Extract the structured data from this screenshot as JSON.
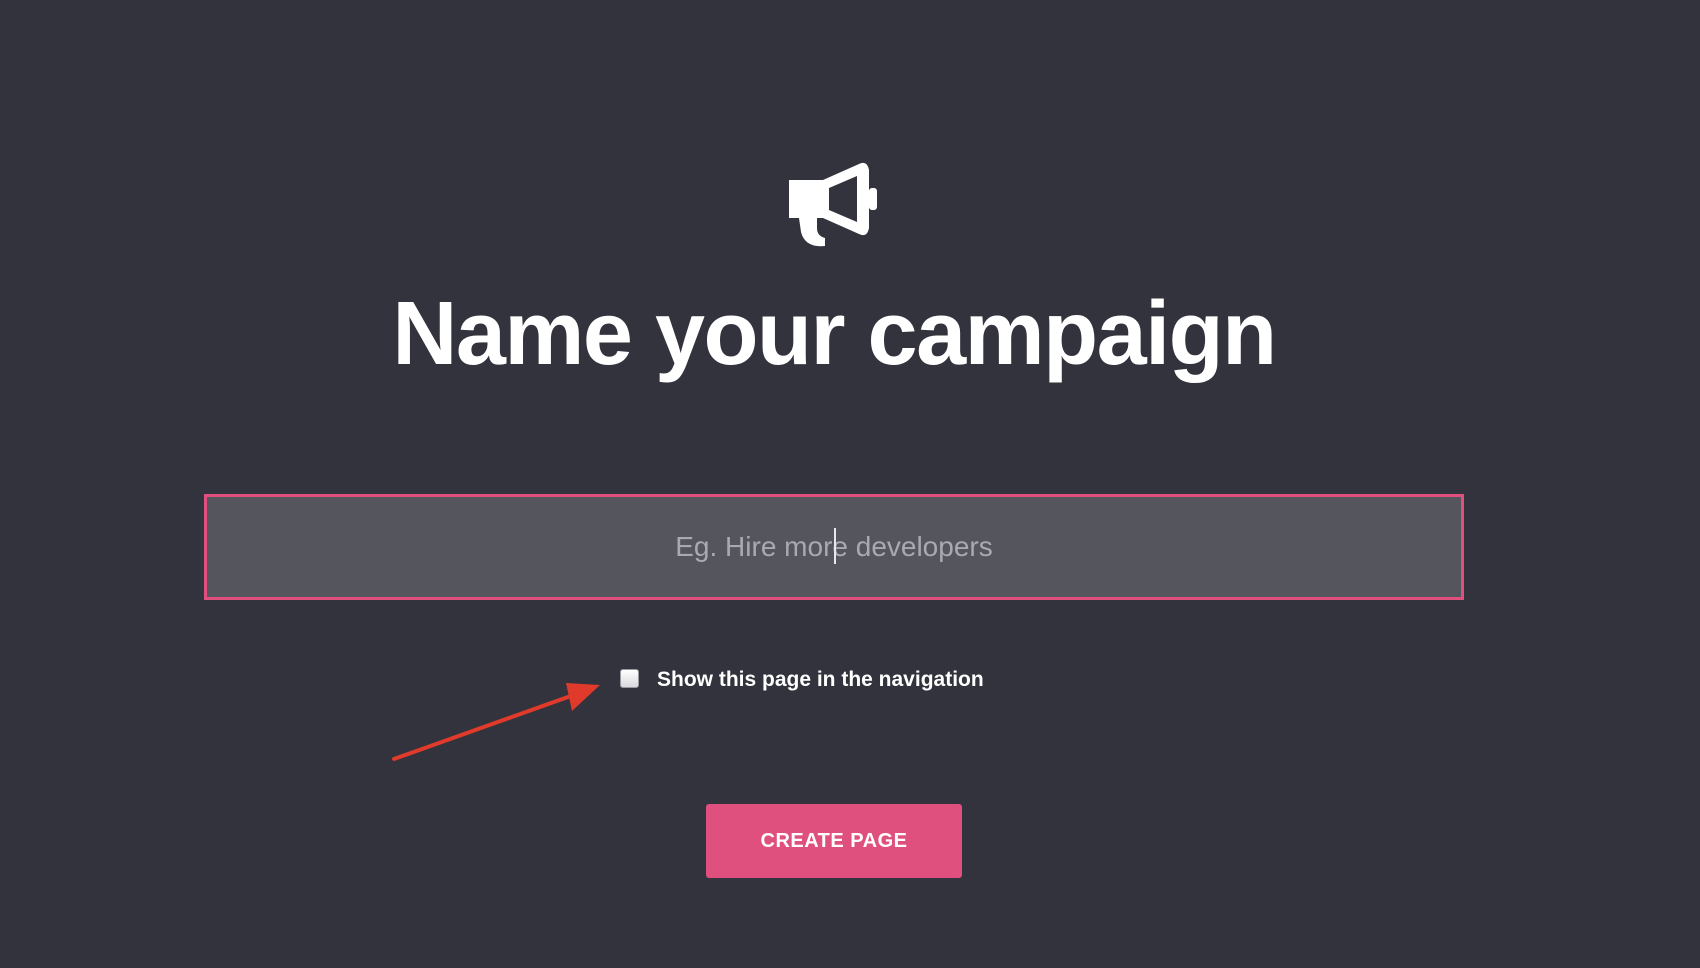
{
  "header": {
    "icon": "megaphone-icon",
    "title": "Name your campaign"
  },
  "form": {
    "campaign_name": {
      "value": "",
      "placeholder": "Eg. Hire more developers"
    },
    "show_in_navigation": {
      "label": "Show this page in the navigation",
      "checked": false
    },
    "submit_label": "CREATE PAGE"
  },
  "annotation": {
    "icon": "arrow-annotation",
    "color": "#e03a2b"
  },
  "colors": {
    "background": "#33333d",
    "accent": "#e0507f",
    "input_background": "#55555e"
  }
}
